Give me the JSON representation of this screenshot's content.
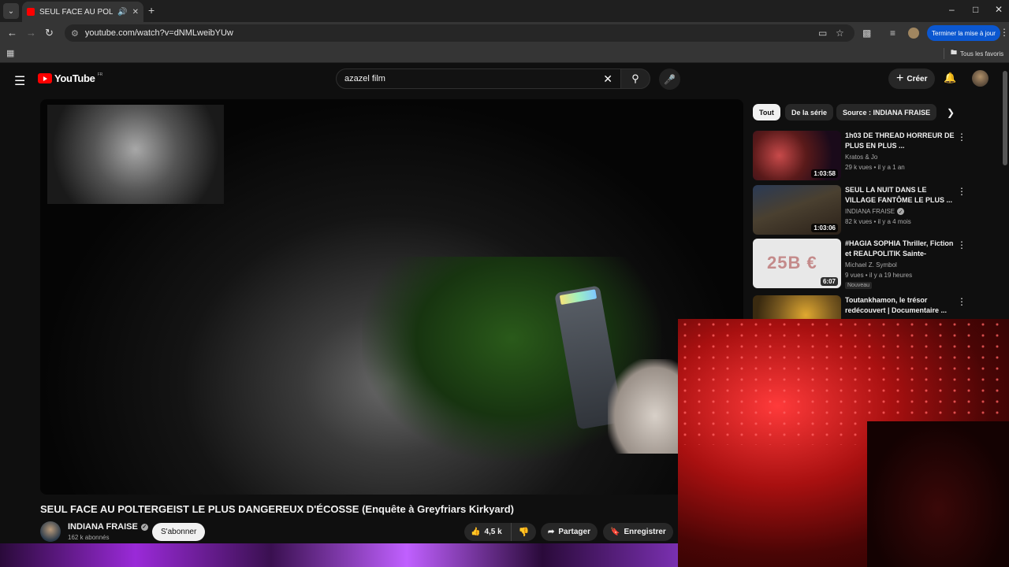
{
  "browser": {
    "tab_title": "SEUL FACE AU POLTERGEIST",
    "url": "youtube.com/watch?v=dNMLweibYUw",
    "update_label": "Terminer la mise à jour",
    "bookmarks_label": "Tous les favoris"
  },
  "youtube": {
    "logo_text": "YouTube",
    "country": "FR",
    "search_value": "azazel film",
    "create_label": "Créer"
  },
  "video": {
    "title": "SEUL FACE AU POLTERGEIST LE PLUS DANGEREUX D'ÉCOSSE (Enquête à Greyfriars Kirkyard)",
    "channel": "INDIANA FRAISE",
    "subscribers": "162 k abonnés",
    "subscribe_label": "S'abonner",
    "likes": "4,5 k",
    "share_label": "Partager",
    "save_label": "Enregistrer"
  },
  "chips": [
    "Tout",
    "De la série",
    "Source : INDIANA FRAISE"
  ],
  "recommendations": [
    {
      "title": "1h03 DE THREAD HORREUR DE PLUS EN PLUS ...",
      "channel": "Kratos & Jo",
      "verified": false,
      "meta": "29 k vues • il y a 1 an",
      "duration": "1:03:58",
      "badge": ""
    },
    {
      "title": "SEUL LA NUIT DANS LE VILLAGE FANTÔME LE PLUS ...",
      "channel": "INDIANA FRAISE",
      "verified": true,
      "meta": "82 k vues • il y a 4 mois",
      "duration": "1:03:06",
      "badge": ""
    },
    {
      "title": "#HAGIA SOPHIA Thriller, Fiction et REALPOLITIK Sainte-Sophie...",
      "channel": "Michael Z. Symbol",
      "verified": false,
      "meta": "9 vues • il y a 19 heures",
      "duration": "6:07",
      "badge": "Nouveau"
    },
    {
      "title": "Toutankhamon, le trésor redécouvert | Documentaire ...",
      "channel": "",
      "verified": false,
      "meta": "",
      "duration": "",
      "badge": ""
    }
  ],
  "thumb_text": {
    "third": "25B €"
  },
  "colors": {
    "yt_red": "#ff0000",
    "bg": "#0f0f0f",
    "chip_bg": "#272727",
    "update_blue": "#0b57d0"
  }
}
